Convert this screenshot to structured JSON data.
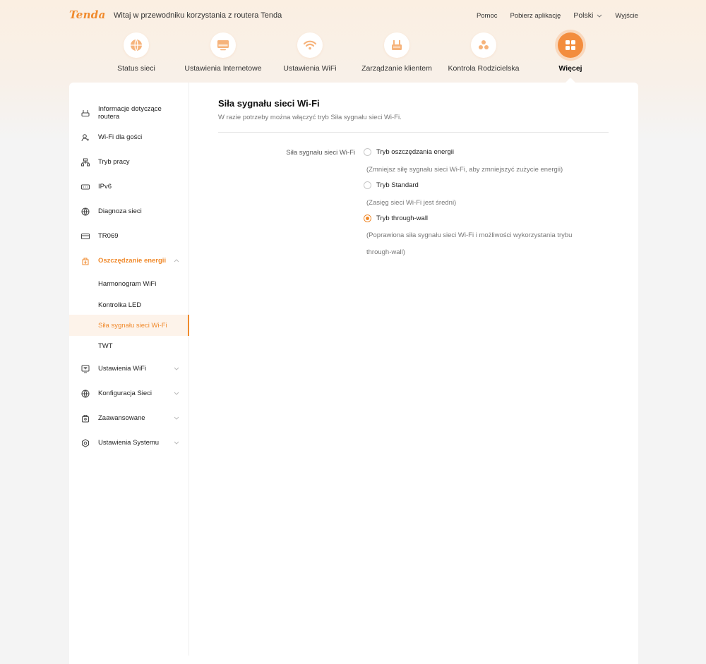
{
  "colors": {
    "accent": "#f08a2c",
    "accent_light": "#fdf3ea"
  },
  "header": {
    "logo": "Tenda",
    "welcome": "Witaj w przewodniku korzystania z routera Tenda",
    "help": "Pomoc",
    "download_app": "Pobierz aplikację",
    "language": "Polski",
    "logout": "Wyjście"
  },
  "nav": {
    "items": [
      {
        "label": "Status sieci",
        "icon": "globe-icon"
      },
      {
        "label": "Ustawienia Internetowe",
        "icon": "monitor-icon"
      },
      {
        "label": "Ustawienia WiFi",
        "icon": "wifi-icon"
      },
      {
        "label": "Zarządzanie klientem",
        "icon": "router-icon"
      },
      {
        "label": "Kontrola Rodzicielska",
        "icon": "family-icon"
      },
      {
        "label": "Więcej",
        "icon": "grid-icon",
        "active": true
      }
    ]
  },
  "sidebar": {
    "items": [
      {
        "label": "Informacje dotyczące routera",
        "icon": "router-icon"
      },
      {
        "label": "Wi-Fi dla gości",
        "icon": "guest-icon"
      },
      {
        "label": "Tryb pracy",
        "icon": "mode-icon"
      },
      {
        "label": "IPv6",
        "icon": "ipv6-icon"
      },
      {
        "label": "Diagnoza sieci",
        "icon": "globe-icon"
      },
      {
        "label": "TR069",
        "icon": "tr069-icon"
      },
      {
        "label": "Oszczędzanie energii",
        "icon": "energy-icon",
        "expanded": true
      },
      {
        "label": "Ustawienia WiFi",
        "icon": "wifi-settings-icon"
      },
      {
        "label": "Konfiguracja Sieci",
        "icon": "globe-icon"
      },
      {
        "label": "Zaawansowane",
        "icon": "advanced-icon"
      },
      {
        "label": "Ustawienia Systemu",
        "icon": "system-icon"
      }
    ],
    "subitems": [
      {
        "label": "Harmonogram WiFi"
      },
      {
        "label": "Kontrolka LED"
      },
      {
        "label": "Siła sygnału sieci Wi-Fi",
        "active": true
      },
      {
        "label": "TWT"
      }
    ]
  },
  "content": {
    "title": "Siła sygnału sieci Wi-Fi",
    "description": "W razie potrzeby można włączyć tryb Siła sygnału sieci Wi-Fi.",
    "field_label": "Siła sygnału sieci Wi-Fi",
    "options": [
      {
        "label": "Tryb oszczędzania energii",
        "description": "(Zmniejsz siłę sygnału sieci Wi-Fi, aby zmniejszyć zużycie energii)",
        "checked": false
      },
      {
        "label": "Tryb Standard",
        "description": "(Zasięg sieci Wi-Fi jest średni)",
        "checked": false
      },
      {
        "label": "Tryb through-wall",
        "description_line1": "(Poprawiona siła sygnału sieci Wi-Fi i możliwości wykorzystania trybu",
        "description_line2": "through-wall)",
        "checked": true
      }
    ]
  }
}
